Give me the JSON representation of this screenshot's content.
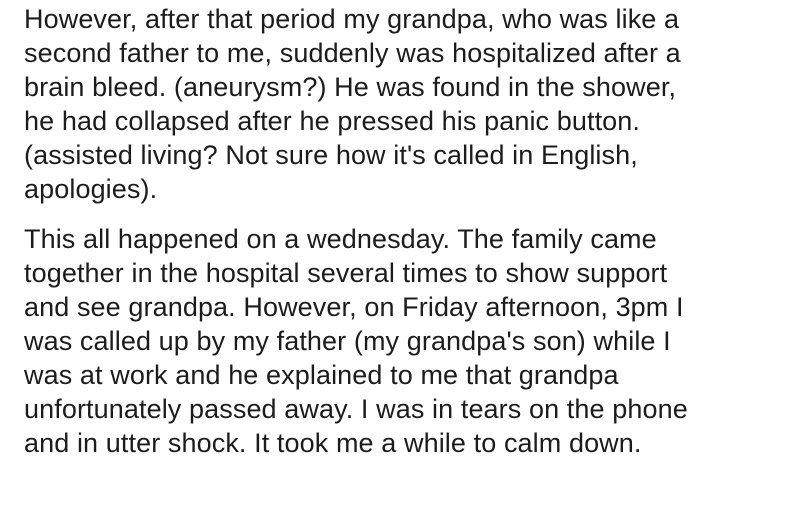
{
  "post": {
    "paragraphs": [
      {
        "lines": [
          "However, after that period my grandpa, who was like a",
          "second father to me, suddenly was hospitalized after a",
          "brain bleed. (aneurysm?) He was found in the shower,",
          "he had collapsed after he pressed his panic button.",
          "(assisted living? Not sure how it's called in English,",
          "apologies)."
        ]
      },
      {
        "lines": [
          "This all happened on a wednesday. The family came",
          "together in the hospital several times to show support",
          "and see grandpa. However, on Friday afternoon, 3pm I",
          "was called up by my father (my grandpa's son) while I",
          "was at work and he explained to me that grandpa",
          "unfortunately passed away. I was in tears on the phone",
          "and in utter shock. It took me a while to calm down."
        ]
      }
    ]
  }
}
